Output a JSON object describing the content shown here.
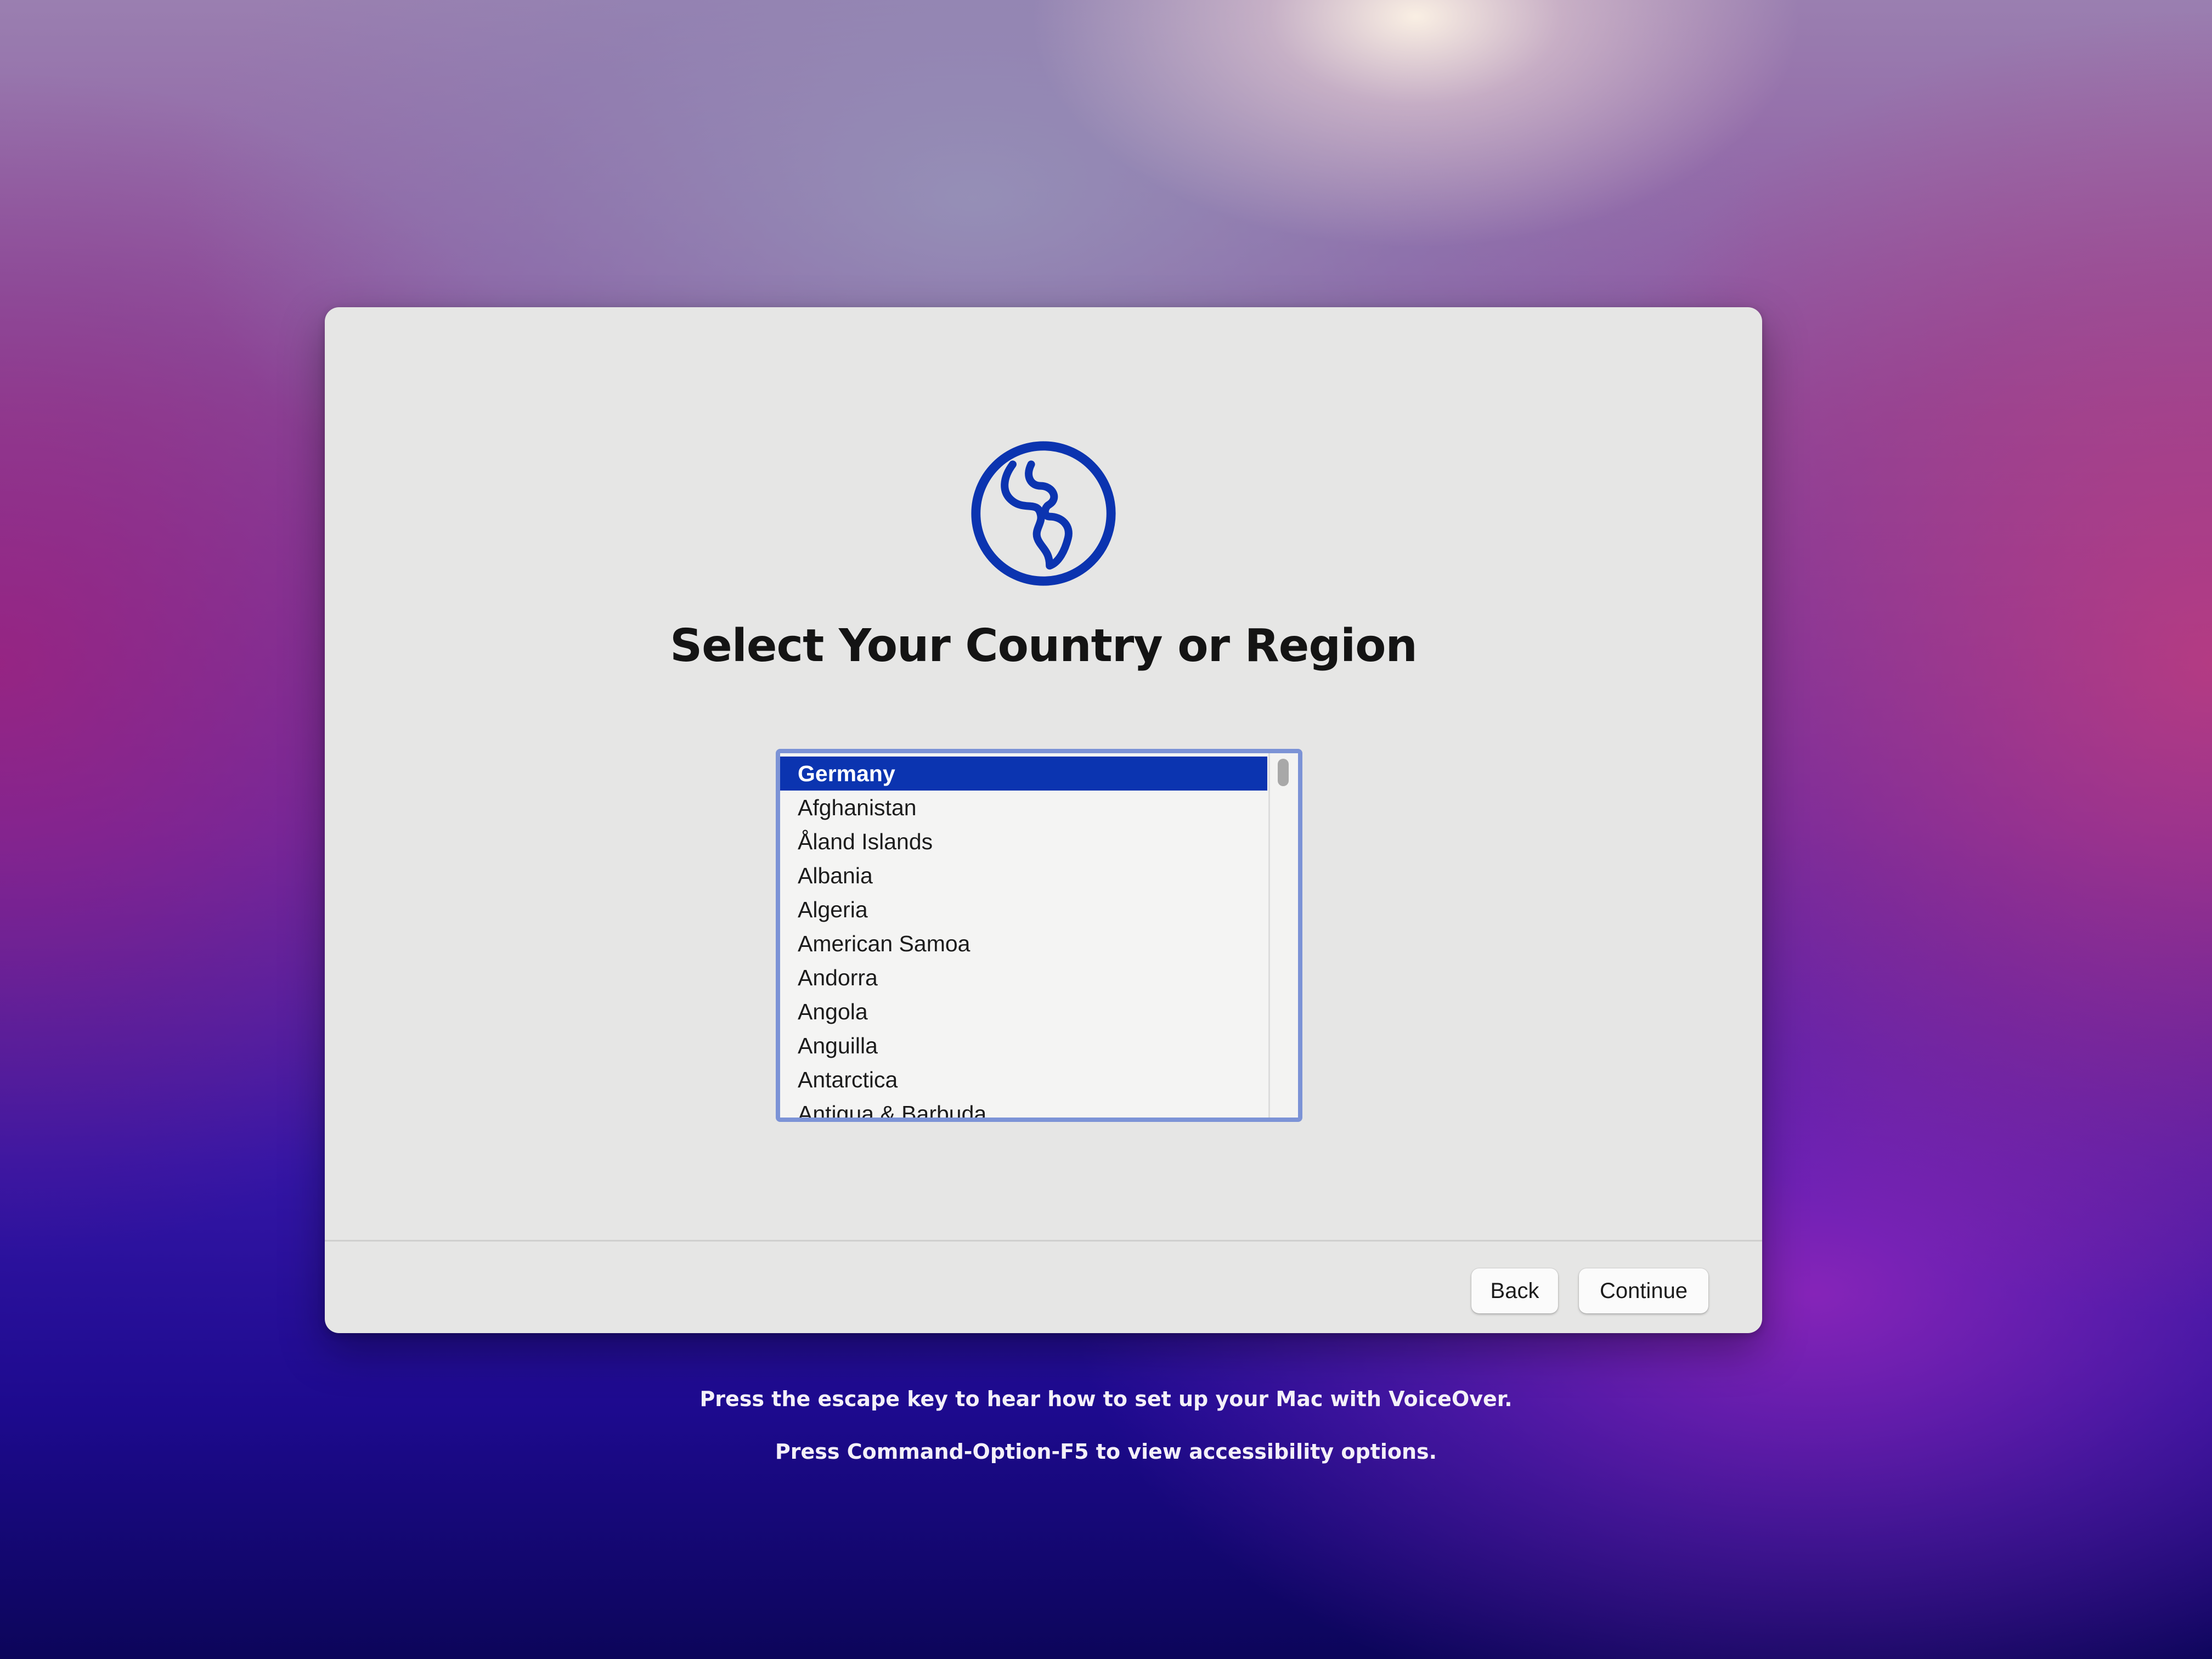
{
  "setup": {
    "title": "Select Your Country or Region",
    "globe_icon": "globe-icon",
    "selected_country": "Germany",
    "countries": [
      "Germany",
      "Afghanistan",
      "Åland Islands",
      "Albania",
      "Algeria",
      "American Samoa",
      "Andorra",
      "Angola",
      "Anguilla",
      "Antarctica",
      "Antigua & Barbuda"
    ],
    "back_label": "Back",
    "continue_label": "Continue"
  },
  "hints": {
    "voiceover": "Press the escape key to hear how to set up your Mac with VoiceOver.",
    "accessibility": "Press Command-Option-F5 to view accessibility options."
  },
  "colors": {
    "accent": "#0b34b0",
    "list_border": "#7c93d6",
    "window_background": "#e6e6e5"
  }
}
